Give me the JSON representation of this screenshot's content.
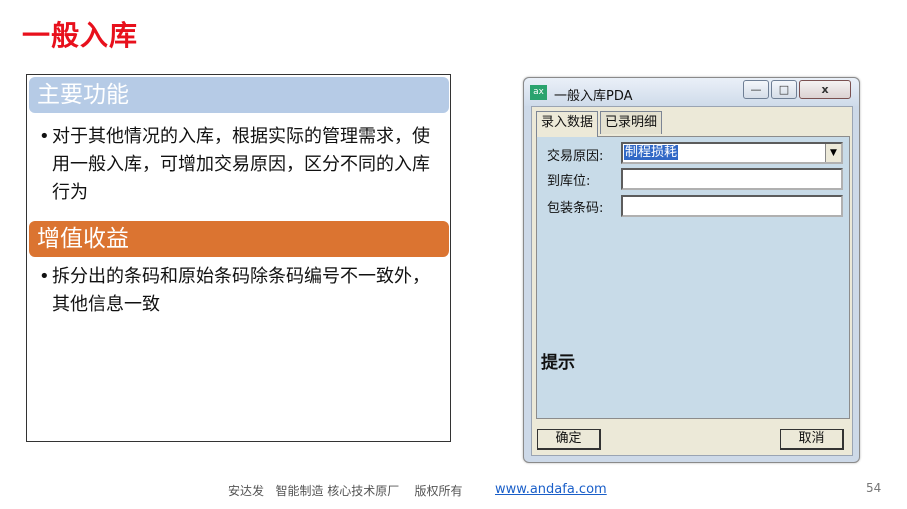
{
  "slide": {
    "title": "一般入库",
    "sections": [
      {
        "heading": "主要功能",
        "bullet": "对于其他情况的入库，根据实际的管理需求，使用一般入库，可增加交易原因，区分不同的入库行为",
        "color": "#b6cbe6"
      },
      {
        "heading": "增值收益",
        "bullet": "拆分出的条码和原始条码除条码编号不一致外，其他信息一致",
        "color": "#db7431"
      }
    ],
    "bullet_glyph": "•"
  },
  "pda_window": {
    "icon_text": "ax",
    "title": "一般入库PDA",
    "controls": {
      "minimize": "—",
      "maximize": "□",
      "close": "x"
    },
    "tabs": [
      "录入数据",
      "已录明细"
    ],
    "form": {
      "reason_label": "交易原因:",
      "reason_value": "制程损耗",
      "location_label": "到库位:",
      "location_value": "",
      "barcode_label": "包装条码:",
      "barcode_value": ""
    },
    "hint_label": "提示",
    "confirm_label": "确定",
    "cancel_label": "取消"
  },
  "footer": {
    "text": "安达发   智能制造 核心技术原厂    版权所有",
    "link": "www.andafa.com",
    "page": "54"
  }
}
